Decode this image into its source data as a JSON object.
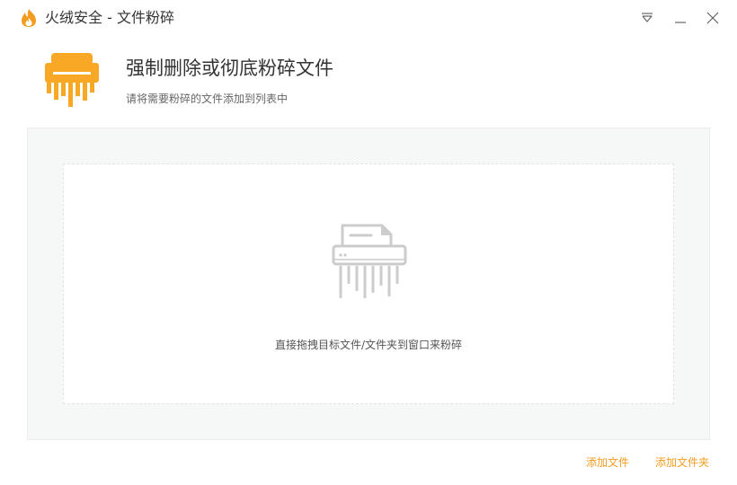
{
  "window": {
    "title": "火绒安全 - 文件粉碎",
    "controls": {
      "menu_icon": "dropdown-menu-icon",
      "minimize_icon": "minimize-icon",
      "close_icon": "close-icon"
    }
  },
  "header": {
    "icon": "file-shredder-icon",
    "title": "强制删除或彻底粉碎文件",
    "subtitle": "请将需要粉碎的文件添加到列表中"
  },
  "drop_zone": {
    "icon": "shredder-outline-icon",
    "hint": "直接拖拽目标文件/文件夹到窗口来粉碎"
  },
  "actions": {
    "add_file": "添加文件",
    "add_folder": "添加文件夹"
  },
  "colors": {
    "accent": "#f39c1f",
    "brand_orange": "#f9a825",
    "panel_bg": "#f6f7f7",
    "icon_gray": "#cccccc"
  }
}
